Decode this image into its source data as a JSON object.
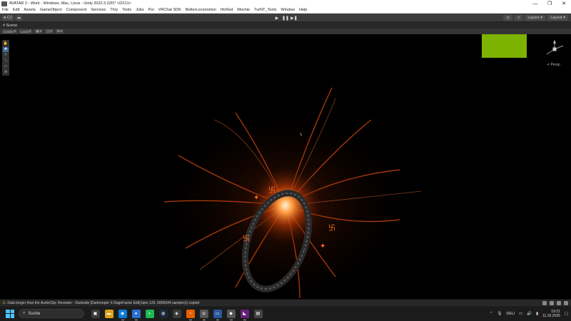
{
  "window": {
    "title": "AVATAR 2 - Work - Windows, Mac, Linux - Unity 2022.3.22f1* <DX11>",
    "minimize": "—",
    "maximize": "❐",
    "close": "✕"
  },
  "menu": [
    "File",
    "Edit",
    "Assets",
    "GameObject",
    "Component",
    "Services",
    "Thry",
    "Tools",
    "Jobs",
    "Poi",
    "VRChat SDK",
    "BetterLocomotion",
    "hfcRed",
    "Mochie",
    "TurNT_Tools",
    "Window",
    "Help"
  ],
  "toolbar": {
    "account": "CJ",
    "cloud_icon": "cloud-icon",
    "play": "▶",
    "pause": "❚❚",
    "step": "▶❚",
    "history_icon": "history-icon",
    "search_icon": "search-icon",
    "layers": "Layers",
    "layout": "Layout"
  },
  "scene_tab": {
    "label": "Scene"
  },
  "scene_toolbar": {
    "pivot": "Center",
    "space": "Local"
  },
  "viewport": {
    "persp_label": "≺ Persp",
    "overlay_color": "#7bb300"
  },
  "status": {
    "message": "Data longer than the AudioClip: Revealer - Darkside [Darkreeper X RageFactor Edit] bpm 125. 5855044 sample(s) copied",
    "warn_icon": "⚠"
  },
  "taskbar": {
    "search_placeholder": "Suche",
    "lang": "DEU",
    "time": "19:21",
    "date": "11.10.2025"
  }
}
